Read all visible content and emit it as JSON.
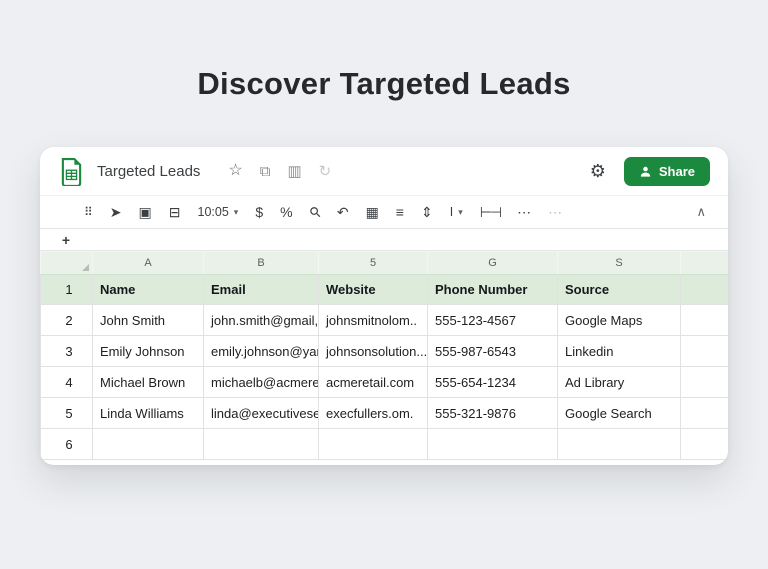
{
  "page": {
    "headline": "Discover Targeted Leads"
  },
  "doc": {
    "title": "Targeted Leads",
    "share_label": "Share",
    "zoom_value": "10:05"
  },
  "colors": {
    "brand_green": "#1b8a3f",
    "header_row_tint": "#dcebda",
    "column_strip_tint": "#e9f1e8",
    "background": "#edeff2"
  },
  "icons": {
    "star": "☆",
    "pages": "⧉",
    "frame": "▥",
    "sync": "↻",
    "gear": "⚙",
    "dots_grid": "⠿",
    "paint": "➤",
    "image": "▣",
    "present": "⊟",
    "caret_down": "▾",
    "dollar": "$",
    "percent": "%",
    "search": "⚲",
    "undo": "↶",
    "borders": "▦",
    "align": "≡",
    "valign": "⇕",
    "text_color": "I",
    "merge": "⊢⊣",
    "overflow": "⋯",
    "more": "⋯",
    "collapse": "∧",
    "select_plus": "+"
  },
  "sheet": {
    "columns": [
      "A",
      "B",
      "5",
      "G",
      "S"
    ],
    "rows": [
      {
        "num": "1",
        "cells": [
          "Name",
          "Email",
          "Website",
          "Phone Number",
          "Source"
        ]
      },
      {
        "num": "2",
        "cells": [
          "John Smith",
          "john.smith@gmail,",
          "johnsmitnolom..",
          "555-123-4567",
          "Google Maps"
        ]
      },
      {
        "num": "3",
        "cells": [
          "Emily Johnson",
          "emily.johnson@yar",
          "johnsonsolution...",
          "555-987-6543",
          "Linkedin"
        ]
      },
      {
        "num": "4",
        "cells": [
          "Michael Brown",
          "michaelb@acmeret",
          "acmeretail.com",
          "555-654-1234",
          "Ad Library"
        ]
      },
      {
        "num": "5",
        "cells": [
          "Linda Williams",
          "linda@executivese",
          "execfullers.om.",
          "555-321-9876",
          "Google Search"
        ]
      },
      {
        "num": "6",
        "cells": [
          "",
          "",
          "",
          "",
          ""
        ]
      }
    ]
  }
}
